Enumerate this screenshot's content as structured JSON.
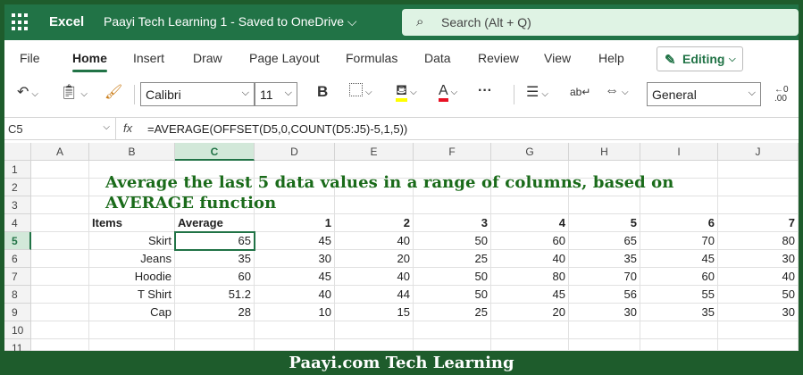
{
  "titlebar": {
    "app_name": "Excel",
    "doc_title": "Paayi Tech Learning 1 - Saved to OneDrive ⌵",
    "search_placeholder": "Search (Alt + Q)"
  },
  "menu": {
    "tabs": [
      "File",
      "Home",
      "Insert",
      "Draw",
      "Page Layout",
      "Formulas",
      "Data",
      "Review",
      "View",
      "Help"
    ],
    "active_tab": "Home",
    "editing_label": "Editing"
  },
  "toolbar": {
    "font_name": "Calibri",
    "font_size": "11",
    "number_format": "General",
    "bold_label": "B",
    "font_color_label": "A",
    "more_label": "···",
    "decimal_label": "←0\n.00"
  },
  "formula_bar": {
    "name_box": "C5",
    "fx_label": "fx",
    "formula": "=AVERAGE(OFFSET(D5,0,COUNT(D5:J5)-5,1,5))"
  },
  "sheet": {
    "columns": [
      "A",
      "B",
      "C",
      "D",
      "E",
      "F",
      "G",
      "H",
      "I",
      "J"
    ],
    "selected_column": "C",
    "rows": [
      "1",
      "2",
      "3",
      "4",
      "5",
      "6",
      "7",
      "8",
      "9",
      "10",
      "11"
    ],
    "selected_row": "5",
    "heading_line1": "Average the last 5 data values in a range of columns, based on",
    "heading_line2": "AVERAGE function",
    "table_headers": [
      "Items",
      "Average",
      "1",
      "2",
      "3",
      "4",
      "5",
      "6",
      "7"
    ],
    "table_rows": [
      {
        "item": "Skirt",
        "average": "65",
        "values": [
          "45",
          "40",
          "50",
          "60",
          "65",
          "70",
          "80"
        ]
      },
      {
        "item": "Jeans",
        "average": "35",
        "values": [
          "30",
          "20",
          "25",
          "40",
          "35",
          "45",
          "30"
        ]
      },
      {
        "item": "Hoodie",
        "average": "60",
        "values": [
          "45",
          "40",
          "50",
          "80",
          "70",
          "60",
          "40"
        ]
      },
      {
        "item": "T Shirt",
        "average": "51.2",
        "values": [
          "40",
          "44",
          "50",
          "45",
          "56",
          "55",
          "50"
        ]
      },
      {
        "item": "Cap",
        "average": "28",
        "values": [
          "10",
          "15",
          "25",
          "20",
          "30",
          "35",
          "30"
        ]
      }
    ]
  },
  "footer": {
    "text": "Paayi.com Tech Learning"
  },
  "colors": {
    "excel_green": "#217346",
    "border_green": "#1e5c2c",
    "heading_green": "#1a6b1a",
    "highlight_yellow": "#ffff00",
    "font_red": "#e81123"
  }
}
